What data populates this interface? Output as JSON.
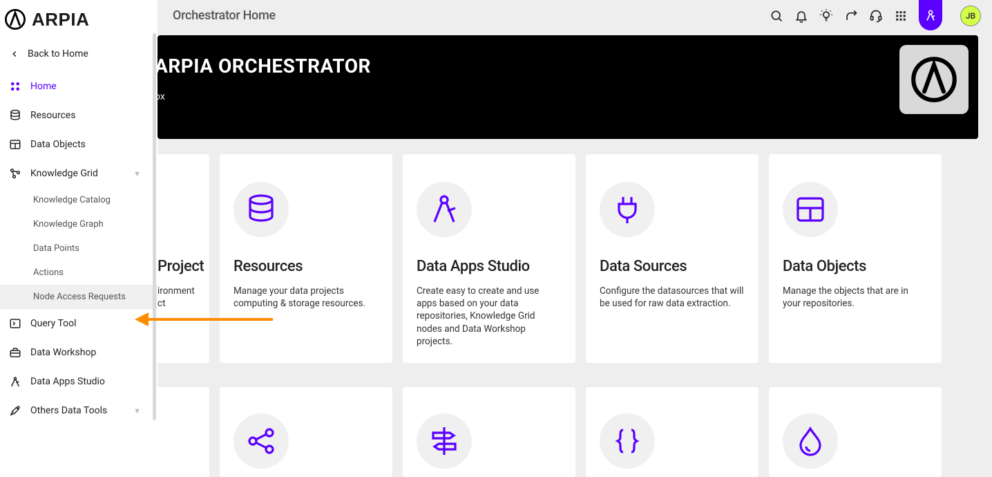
{
  "brand": {
    "name": "ARPIA"
  },
  "topbar": {
    "title": "Orchestrator Home",
    "avatar_initials": "JB"
  },
  "sidebar": {
    "back_label": "Back to Home",
    "items": {
      "home": "Home",
      "resources": "Resources",
      "data_objects": "Data Objects",
      "knowledge_grid": "Knowledge Grid",
      "query_tool": "Query Tool",
      "data_workshop": "Data Workshop",
      "data_apps_studio": "Data Apps Studio",
      "others_data_tools": "Others Data Tools"
    },
    "knowledge_grid_children": {
      "catalog": "Knowledge Catalog",
      "graph": "Knowledge Graph",
      "data_points": "Data Points",
      "actions": "Actions",
      "node_access": "Node Access Requests"
    }
  },
  "hero": {
    "title": "ARPIA ORCHESTRATOR",
    "subtitle": "ox"
  },
  "cards_row1": {
    "c0": {
      "title": "Project",
      "desc": "ironment ct"
    },
    "c1": {
      "title": "Resources",
      "desc": "Manage your data projects computing & storage resources."
    },
    "c2": {
      "title": "Data Apps Studio",
      "desc": "Create easy to create and use apps based on your data repositories, Knowledge Grid nodes and Data Workshop projects."
    },
    "c3": {
      "title": "Data Sources",
      "desc": "Configure the datasources that will be used for raw data extraction."
    },
    "c4": {
      "title": "Data Objects",
      "desc": "Manage the objects that are in your repositories."
    }
  }
}
